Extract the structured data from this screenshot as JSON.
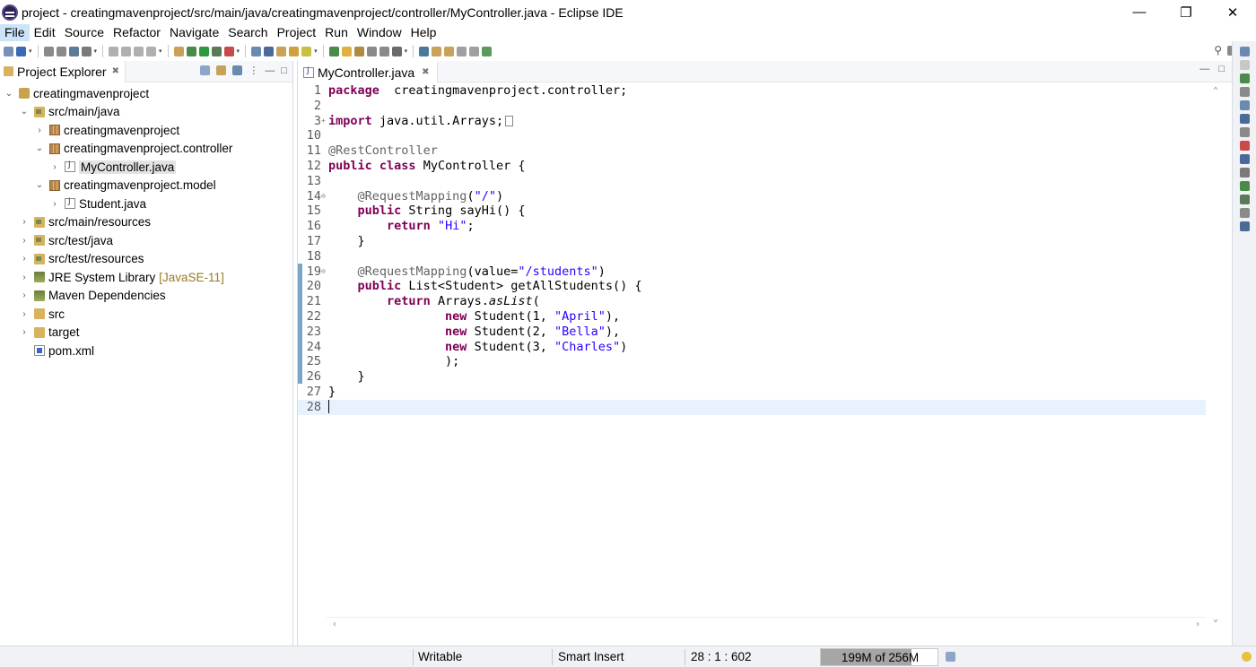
{
  "window": {
    "title": "project - creatingmavenproject/src/main/java/creatingmavenproject/controller/MyController.java - Eclipse IDE",
    "minimize": "—",
    "restore": "❐",
    "close": "✕"
  },
  "menu": [
    {
      "label": "File",
      "active": true
    },
    {
      "label": "Edit"
    },
    {
      "label": "Source"
    },
    {
      "label": "Refactor"
    },
    {
      "label": "Navigate"
    },
    {
      "label": "Search"
    },
    {
      "label": "Project"
    },
    {
      "label": "Run"
    },
    {
      "label": "Window"
    },
    {
      "label": "Help"
    }
  ],
  "explorer": {
    "tab_label": "Project Explorer",
    "close": "✖",
    "tree": [
      {
        "label": "creatingmavenproject",
        "icon": "project-icon",
        "chev": "⌄",
        "indent": 0
      },
      {
        "label": "src/main/java",
        "icon": "source-folder-icon",
        "chev": "⌄",
        "indent": 1
      },
      {
        "label": "creatingmavenproject",
        "icon": "package-icon",
        "chev": "›",
        "indent": 2
      },
      {
        "label": "creatingmavenproject.controller",
        "icon": "package-icon",
        "chev": "⌄",
        "indent": 2
      },
      {
        "label": "MyController.java",
        "icon": "java-file-icon",
        "chev": "›",
        "indent": 3,
        "selected": true
      },
      {
        "label": "creatingmavenproject.model",
        "icon": "package-icon",
        "chev": "⌄",
        "indent": 2
      },
      {
        "label": "Student.java",
        "icon": "java-file-icon",
        "chev": "›",
        "indent": 3
      },
      {
        "label": "src/main/resources",
        "icon": "source-folder-icon",
        "chev": "›",
        "indent": 1
      },
      {
        "label": "src/test/java",
        "icon": "source-folder-icon",
        "chev": "›",
        "indent": 1
      },
      {
        "label": "src/test/resources",
        "icon": "source-folder-icon",
        "chev": "›",
        "indent": 1
      },
      {
        "label": "JRE System Library",
        "suffix": "[JavaSE-11]",
        "icon": "library-icon",
        "chev": "›",
        "indent": 1
      },
      {
        "label": "Maven Dependencies",
        "icon": "library-icon",
        "chev": "›",
        "indent": 1
      },
      {
        "label": "src",
        "icon": "folder-icon",
        "chev": "›",
        "indent": 1
      },
      {
        "label": "target",
        "icon": "folder-icon",
        "chev": "›",
        "indent": 1
      },
      {
        "label": "pom.xml",
        "icon": "xml-file-icon",
        "chev": "",
        "indent": 1
      }
    ]
  },
  "editor": {
    "tab_label": "MyController.java",
    "close": "✖",
    "lines": [
      {
        "n": "1",
        "segs": [
          [
            "kw",
            "package"
          ],
          [
            "",
            "  creatingmavenproject.controller;"
          ]
        ]
      },
      {
        "n": "2",
        "segs": []
      },
      {
        "n": "3",
        "fold": "+",
        "segs": [
          [
            "kw",
            "import"
          ],
          [
            "",
            " java.util.Arrays;"
          ]
        ],
        "folded": true
      },
      {
        "n": "10",
        "segs": []
      },
      {
        "n": "11",
        "segs": [
          [
            "ann",
            "@RestController"
          ]
        ]
      },
      {
        "n": "12",
        "segs": [
          [
            "kw",
            "public"
          ],
          [
            "",
            " "
          ],
          [
            "kw",
            "class"
          ],
          [
            "",
            " MyController {"
          ]
        ]
      },
      {
        "n": "13",
        "segs": []
      },
      {
        "n": "14",
        "fold": "⊖",
        "segs": [
          [
            "",
            "    "
          ],
          [
            "ann",
            "@RequestMapping"
          ],
          [
            "",
            "("
          ],
          [
            "str",
            "\"/\""
          ],
          [
            "",
            ")"
          ]
        ]
      },
      {
        "n": "15",
        "segs": [
          [
            "",
            "    "
          ],
          [
            "kw",
            "public"
          ],
          [
            "",
            " String sayHi() {"
          ]
        ]
      },
      {
        "n": "16",
        "segs": [
          [
            "",
            "        "
          ],
          [
            "kw",
            "return"
          ],
          [
            "",
            " "
          ],
          [
            "str",
            "\"Hi\""
          ],
          [
            "",
            ";"
          ]
        ]
      },
      {
        "n": "17",
        "segs": [
          [
            "",
            "    }"
          ]
        ]
      },
      {
        "n": "18",
        "segs": []
      },
      {
        "n": "19",
        "fold": "⊖",
        "segs": [
          [
            "",
            "    "
          ],
          [
            "ann",
            "@RequestMapping"
          ],
          [
            "",
            "(value="
          ],
          [
            "str",
            "\"/students\""
          ],
          [
            "",
            ")"
          ]
        ]
      },
      {
        "n": "20",
        "segs": [
          [
            "",
            "    "
          ],
          [
            "kw",
            "public"
          ],
          [
            "",
            " List<Student> getAllStudents() {"
          ]
        ]
      },
      {
        "n": "21",
        "segs": [
          [
            "",
            "        "
          ],
          [
            "kw",
            "return"
          ],
          [
            "",
            " Arrays."
          ],
          [
            "itl",
            "asList"
          ],
          [
            "",
            "("
          ]
        ]
      },
      {
        "n": "22",
        "segs": [
          [
            "",
            "                "
          ],
          [
            "kw",
            "new"
          ],
          [
            "",
            " Student(1, "
          ],
          [
            "str",
            "\"April\""
          ],
          [
            "",
            "),"
          ]
        ]
      },
      {
        "n": "23",
        "segs": [
          [
            "",
            "                "
          ],
          [
            "kw",
            "new"
          ],
          [
            "",
            " Student(2, "
          ],
          [
            "str",
            "\"Bella\""
          ],
          [
            "",
            "),"
          ]
        ]
      },
      {
        "n": "24",
        "segs": [
          [
            "",
            "                "
          ],
          [
            "kw",
            "new"
          ],
          [
            "",
            " Student(3, "
          ],
          [
            "str",
            "\"Charles\""
          ],
          [
            "",
            ")"
          ]
        ]
      },
      {
        "n": "25",
        "segs": [
          [
            "",
            "                );"
          ]
        ]
      },
      {
        "n": "26",
        "segs": [
          [
            "",
            "    }"
          ]
        ]
      },
      {
        "n": "27",
        "segs": [
          [
            "",
            "}"
          ]
        ]
      },
      {
        "n": "28",
        "segs": [],
        "current": true
      }
    ]
  },
  "status": {
    "writable": "Writable",
    "insert_mode": "Smart Insert",
    "position": "28 : 1 : 602",
    "heap": "199M of 256M",
    "heap_used_fraction": 0.777
  },
  "colors": {
    "keyword": "#7f0055",
    "string": "#2a00ff",
    "annotation": "#646464",
    "selection": "#cce4f7"
  }
}
